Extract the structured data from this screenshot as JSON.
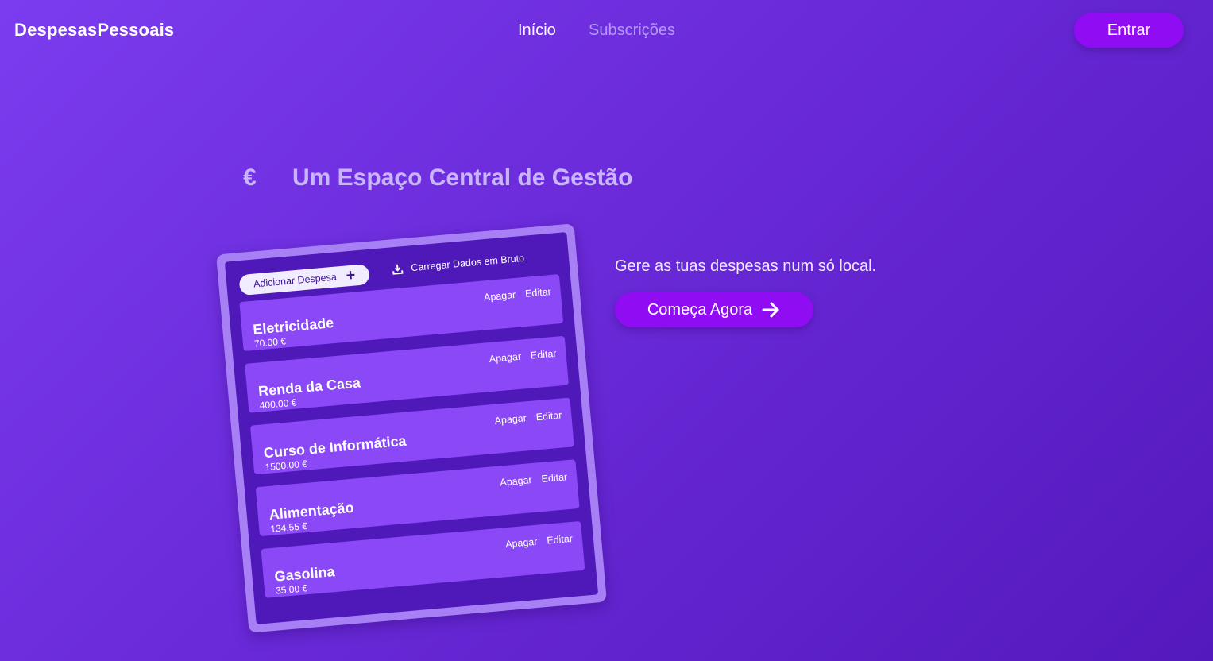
{
  "nav": {
    "brand": "DespesasPessoais",
    "links": [
      {
        "label": "Início",
        "active": true
      },
      {
        "label": "Subscrições",
        "active": false
      }
    ],
    "login_label": "Entrar"
  },
  "hero": {
    "currency_symbol": "€",
    "title": "Um Espaço Central de Gestão",
    "tagline": "Gere as tuas despesas num só local.",
    "cta_label": "Começa Agora",
    "cta_icon": "arrow-right-icon"
  },
  "mockup": {
    "add_label": "Adicionar Despesa",
    "add_icon": "plus-icon",
    "upload_label": "Carregar Dados em Bruto",
    "upload_icon": "download-icon",
    "delete_label": "Apagar",
    "edit_label": "Editar",
    "expenses": [
      {
        "name": "Eletricidade",
        "amount": "70.00 €"
      },
      {
        "name": "Renda da Casa",
        "amount": "400.00 €"
      },
      {
        "name": "Curso de Informática",
        "amount": "1500.00 €"
      },
      {
        "name": "Alimentação",
        "amount": "134.55 €"
      },
      {
        "name": "Gasolina",
        "amount": "35.00 €"
      }
    ]
  },
  "colors": {
    "background_start": "#7b3cef",
    "background_end": "#5419bd",
    "accent_button": "#8f0cf3",
    "muted_link": "#b49af4",
    "card_frame": "#a880f5",
    "card_inner": "#4f18b8",
    "expense_row": "#8a48f6"
  }
}
